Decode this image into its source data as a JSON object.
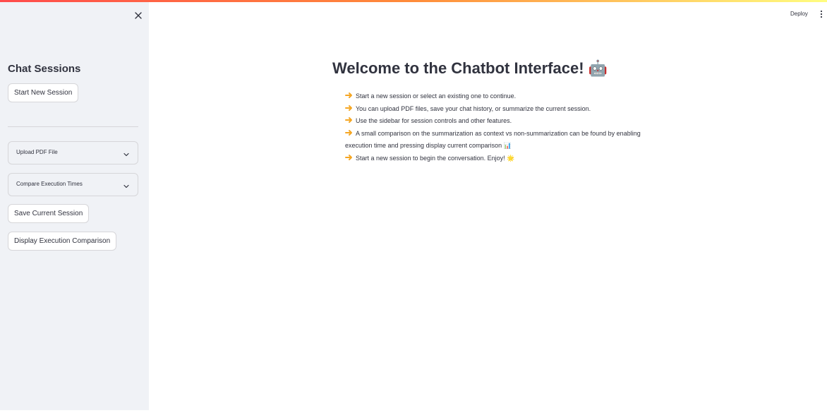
{
  "header": {
    "deploy_label": "Deploy"
  },
  "sidebar": {
    "title": "Chat Sessions",
    "start_new_session": "Start New Session",
    "expanders": [
      {
        "label": "Upload PDF File"
      },
      {
        "label": "Compare Execution Times"
      }
    ],
    "save_session": "Save Current Session",
    "display_comparison": "Display Execution Comparison"
  },
  "main": {
    "title": "Welcome to the Chatbot Interface! 🤖",
    "bullets": [
      "Start a new session or select an existing one to continue.",
      "You can upload PDF files, save your chat history, or summarize the current session.",
      "Use the sidebar for session controls and other features.",
      "A small comparison on the summarization as context vs non-summarization can be found by enabling execution time and pressing display current comparison 📊",
      "Start a new session to begin the conversation. Enjoy! 🌟"
    ]
  },
  "colors": {
    "accent_gradient_start": "#ff4b4b",
    "accent_gradient_end": "#fffd80",
    "sidebar_bg": "#f0f2f6",
    "text": "#31333f",
    "border": "#d6d6d9"
  },
  "icons": {
    "close": "close-icon",
    "chevron": "chevron-down-icon",
    "menu": "more-vertical-icon",
    "bullet": "pointing-right-hand-icon"
  }
}
